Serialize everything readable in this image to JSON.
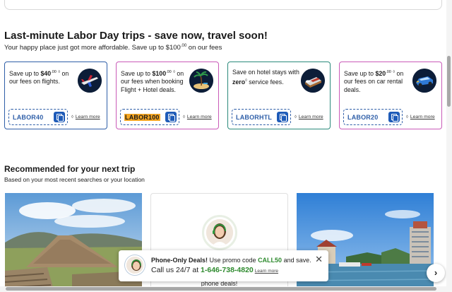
{
  "promo": {
    "title": "Last-minute Labor Day trips - save now, travel soon!",
    "subtitle_pre": "Your happy place just got more affordable. Save up to $100",
    "subtitle_sup": ".00",
    "subtitle_post": " on our fees"
  },
  "cards": [
    {
      "text_pre": "Save up to ",
      "amount": "$40",
      "amount_sup": ".00",
      "mark": "◊",
      "text_post": " on our fees on flights.",
      "code": "LABOR40",
      "learn_more": "Learn more",
      "icon": "airplane-icon"
    },
    {
      "text_pre": "Save up to ",
      "amount": "$100",
      "amount_sup": ".00",
      "mark": "◊",
      "text_post": " on our fees when booking Flight + Hotel deals.",
      "code": "LABOR100",
      "learn_more": "Learn more",
      "icon": "island-icon"
    },
    {
      "text_pre": "Save on hotel stays with ",
      "amount": "zero",
      "amount_sup": "",
      "mark": "◊",
      "text_post": " service fees.",
      "code": "LABORHTL",
      "learn_more": "Learn more",
      "icon": "hotel-bed-icon"
    },
    {
      "text_pre": "Save up to ",
      "amount": "$20",
      "amount_sup": ".00",
      "mark": "◊",
      "text_post": " on our fees on car rental deals.",
      "code": "LABOR20",
      "learn_more": "Learn more",
      "icon": "car-icon"
    }
  ],
  "learn_mark": "◊",
  "recommended": {
    "title": "Recommended for your next trip",
    "subtitle": "Based on your most recent searches or your location",
    "phone_tile_text": "phone deals!"
  },
  "toast": {
    "l1_bold": "Phone-Only Deals!",
    "l1_mid": " Use promo code ",
    "code": "CALL50",
    "l1_end": " and save.",
    "l2_pre": "Call us 24/7 at ",
    "phone": "1-646-738-4820",
    "learn_more": "Learn more",
    "close": "✕"
  },
  "carousel": {
    "next": "›"
  },
  "colors": {
    "accent": "#1e5bb8",
    "green": "#2e8a2e",
    "highlight": "#f5a623",
    "pink_border": "#c95ab8",
    "teal_border": "#2a8a7b"
  }
}
